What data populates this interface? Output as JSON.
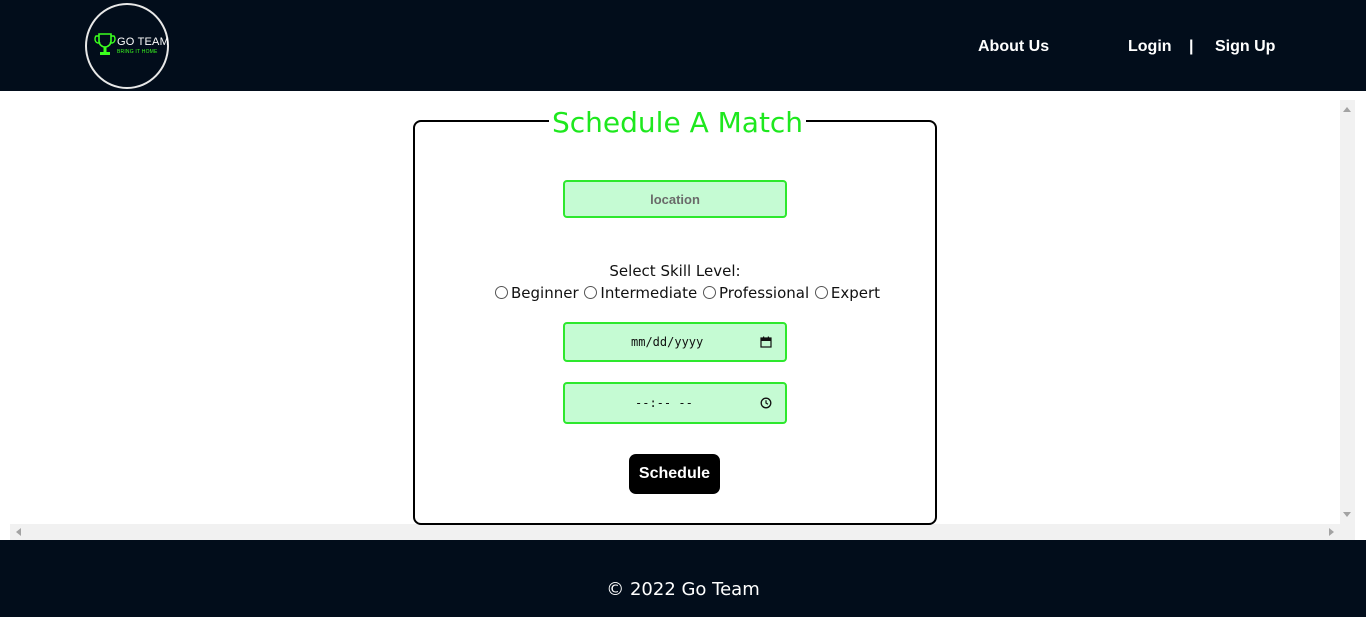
{
  "header": {
    "logo": {
      "title": "GO TEAM",
      "tagline": "BRING IT HOME",
      "icon": "trophy-icon",
      "accent": "#3bff1e"
    },
    "nav": {
      "about": "About Us",
      "login": "Login",
      "separator": "|",
      "signup": "Sign Up"
    }
  },
  "form": {
    "legend": "Schedule A Match",
    "location": {
      "placeholder": "location",
      "value": ""
    },
    "skill": {
      "label": "Select Skill Level:",
      "options": [
        "Beginner",
        "Intermediate",
        "Professional",
        "Expert"
      ],
      "selected": null
    },
    "date": {
      "placeholder": "mm/dd/yyyy",
      "icon": "calendar-icon"
    },
    "time": {
      "placeholder": "--:-- --",
      "icon": "clock-icon"
    },
    "submit_label": "Schedule"
  },
  "footer": {
    "text": "© 2022 Go Team"
  },
  "colors": {
    "header_bg": "#020d1b",
    "accent_green": "#1ee81e",
    "field_bg": "#c5fbd3",
    "field_border": "#2de82d",
    "button_bg": "#000000"
  }
}
